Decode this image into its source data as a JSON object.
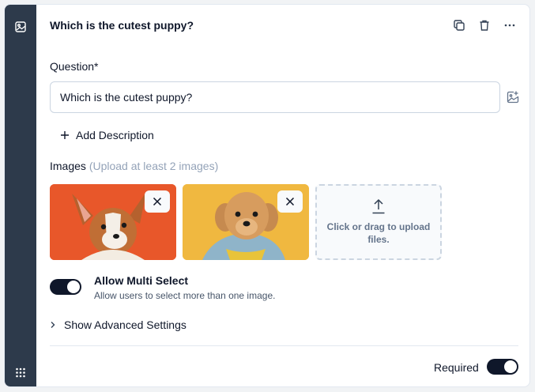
{
  "header": {
    "title": "Which is the cutest puppy?",
    "actions": [
      "copy-icon",
      "trash-icon",
      "more-horizontal-icon"
    ]
  },
  "question": {
    "label": "Question*",
    "value": "Which is the cutest puppy?",
    "add_image_icon": "image-plus-icon"
  },
  "add_description": {
    "label": "Add Description",
    "icon": "plus-icon"
  },
  "images": {
    "label": "Images",
    "hint": "(Upload at least 2 images)",
    "items": [
      {
        "name": "puppy-image-1",
        "background": "#e8572a"
      },
      {
        "name": "puppy-image-2",
        "background": "#f0b840"
      }
    ],
    "upload_text": "Click or drag to upload files."
  },
  "multi_select": {
    "title": "Allow Multi Select",
    "subtitle": "Allow users to select more than one image.",
    "enabled": true
  },
  "advanced": {
    "label": "Show Advanced Settings"
  },
  "required": {
    "label": "Required",
    "enabled": true
  },
  "colors": {
    "rail": "#2d3a4b",
    "toggle_on": "#0f172a",
    "border": "#cbd5e1"
  }
}
